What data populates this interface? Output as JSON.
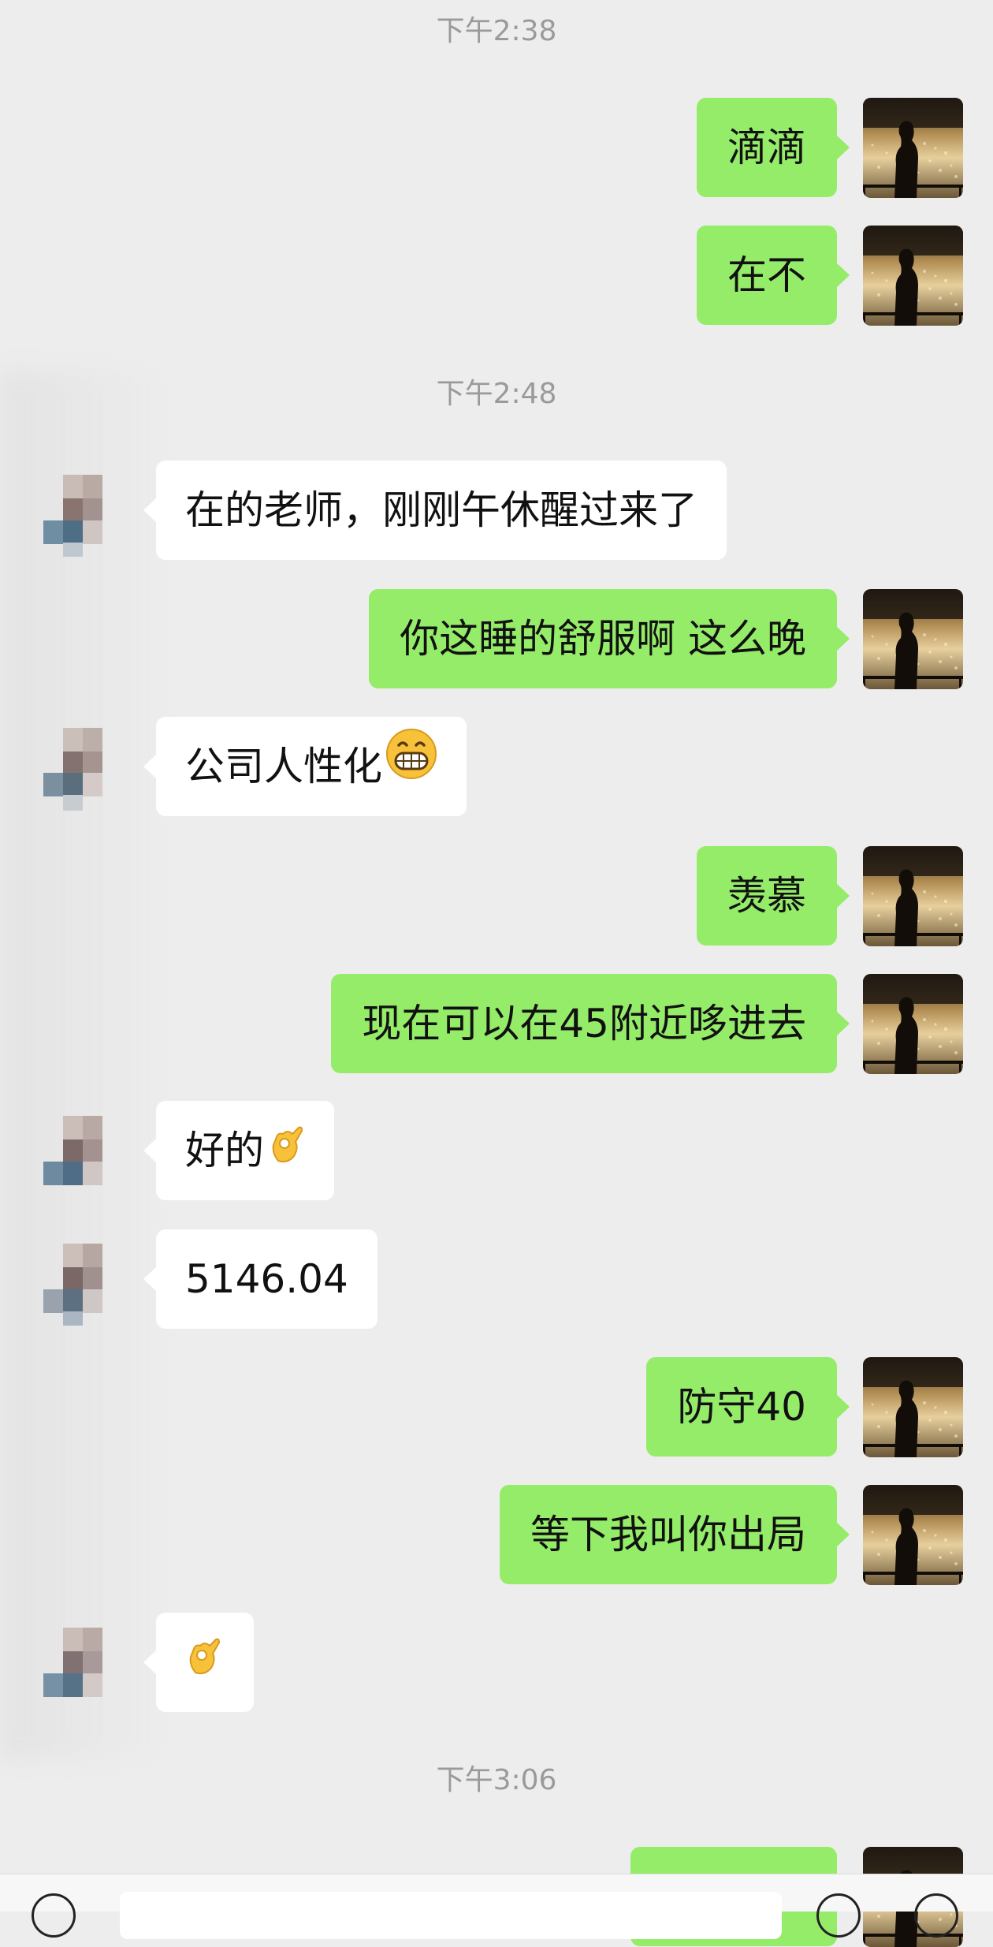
{
  "chat": {
    "timestamps": [
      "下午2:38",
      "下午2:48",
      "下午3:06"
    ],
    "messages": [
      {
        "side": "sent",
        "text": "滴滴"
      },
      {
        "side": "sent",
        "text": "在不"
      },
      {
        "side": "received",
        "text": "在的老师，刚刚午休醒过来了"
      },
      {
        "side": "sent",
        "text": "你这睡的舒服啊 这么晚"
      },
      {
        "side": "received",
        "text": "公司人性化",
        "emoji": "grin-emoji"
      },
      {
        "side": "sent",
        "text": "羡慕"
      },
      {
        "side": "sent",
        "text": "现在可以在45附近哆进去"
      },
      {
        "side": "received",
        "text": "好的",
        "emoji": "ok-hand-emoji"
      },
      {
        "side": "received",
        "text": "5146.04"
      },
      {
        "side": "sent",
        "text": "防守40"
      },
      {
        "side": "sent",
        "text": "等下我叫你出局"
      },
      {
        "side": "received",
        "text": "",
        "emoji": "ok-hand-emoji"
      },
      {
        "side": "sent",
        "text": ""
      }
    ]
  },
  "colors": {
    "background": "#ededed",
    "sent_bubble": "#95ec69",
    "received_bubble": "#ffffff",
    "timestamp_text": "#9a9a9a"
  },
  "icons": {
    "self_avatar": "silhouette-avatar",
    "other_avatar": "pixelated-avatar",
    "input_left": "voice-icon",
    "input_right_1": "emoji-icon",
    "input_right_2": "plus-icon"
  }
}
